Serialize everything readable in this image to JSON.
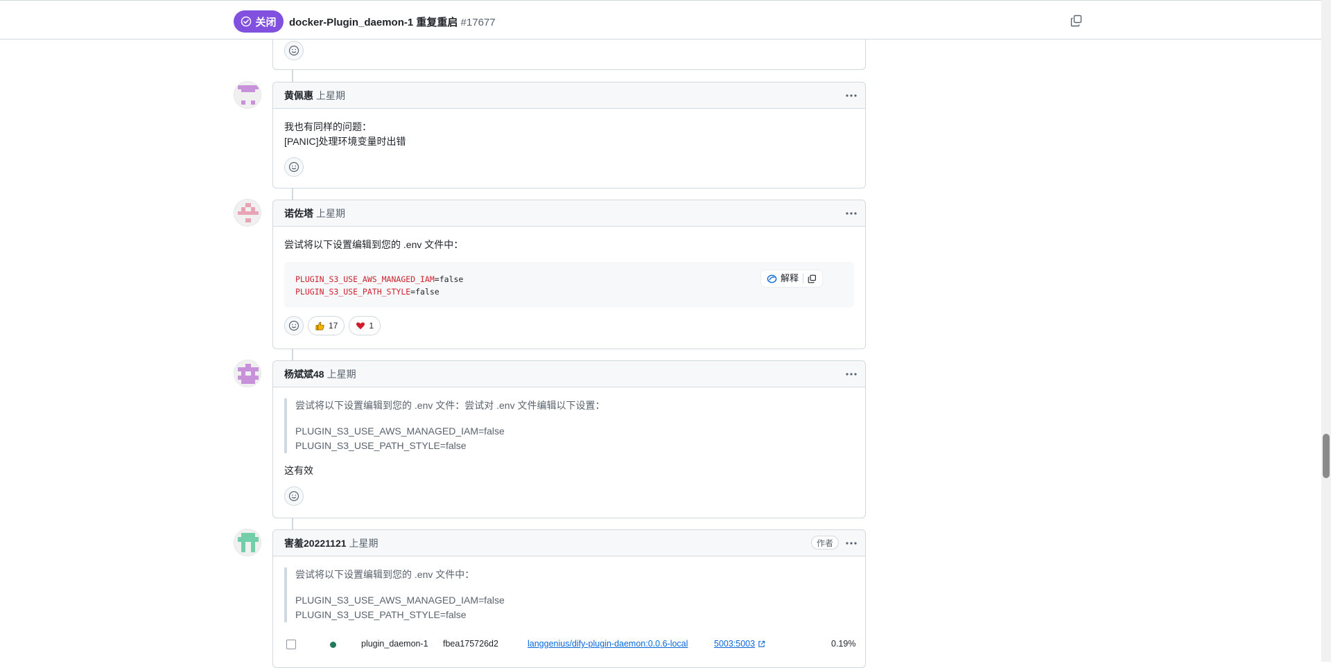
{
  "header": {
    "state_label": "关闭",
    "title": "docker-Plugin_daemon-1 重复重启",
    "issue_number": "#17677",
    "copy_icon": "copy-icon"
  },
  "comments": [
    {
      "author": "黄佩惠",
      "time": "上星期",
      "body": [
        "我也有同样的问题：",
        "[PANIC]处理环境变量时出错"
      ]
    },
    {
      "author": "诺佐塔",
      "time": "上星期",
      "intro": "尝试将以下设置编辑到您的 .env 文件中：",
      "code": [
        {
          "key": "PLUGIN_S3_USE_AWS_MANAGED_IAM",
          "value": "=false"
        },
        {
          "key": "PLUGIN_S3_USE_PATH_STYLE",
          "value": "=false"
        }
      ],
      "code_explain_label": "解释",
      "reactions": {
        "thumbs_up": "17",
        "heart": "1"
      }
    },
    {
      "author": "杨斌斌48",
      "time": "上星期",
      "quote_line": "尝试将以下设置编辑到您的 .env 文件：尝试对 .env 文件编辑以下设置：",
      "quote_settings": [
        "PLUGIN_S3_USE_AWS_MANAGED_IAM=false",
        "PLUGIN_S3_USE_PATH_STYLE=false"
      ],
      "body": "这有效"
    },
    {
      "author": "害羞20221121",
      "time": "上星期",
      "badge": "作者",
      "quote_line": "尝试将以下设置编辑到您的 .env 文件中：",
      "quote_settings": [
        "PLUGIN_S3_USE_AWS_MANAGED_IAM=false",
        "PLUGIN_S3_USE_PATH_STYLE=false"
      ]
    }
  ],
  "container_row": {
    "name": "plugin_daemon-1",
    "id": "fbea175726d2",
    "image": "langgenius/dify-plugin-daemon:0.0.6-local",
    "port": "5003:5003",
    "cpu": "0.19%"
  },
  "colors": {
    "closed_badge": "#8250df",
    "link": "#0969da",
    "code_key": "#cf222e"
  }
}
